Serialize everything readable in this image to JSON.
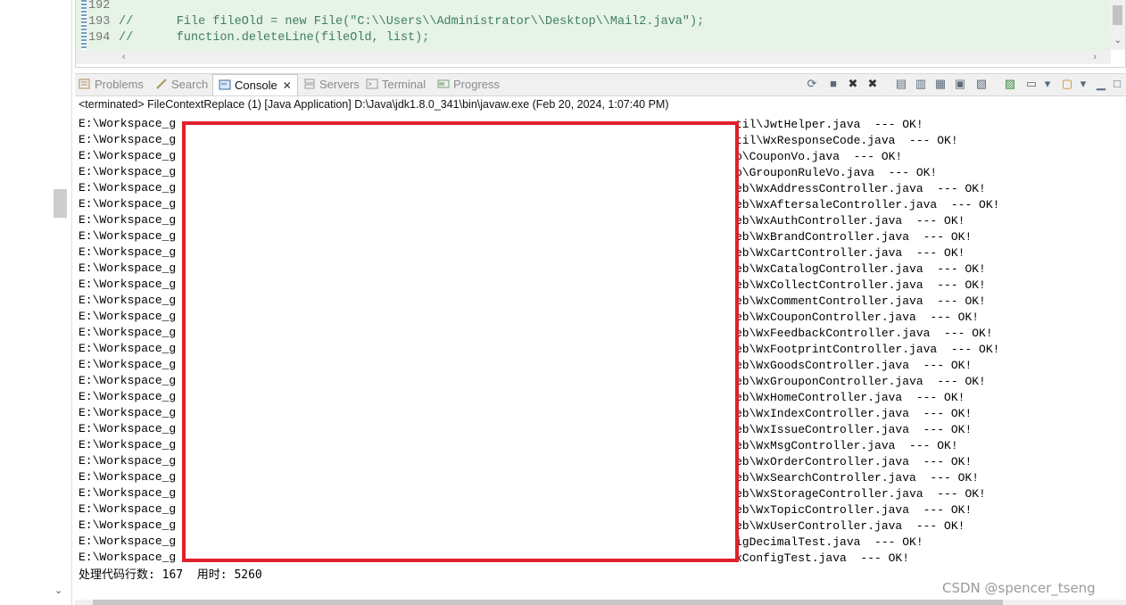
{
  "editor": {
    "lines": [
      {
        "no": "192",
        "text": ""
      },
      {
        "no": "193",
        "text": "//      File fileOld = new File(\"C:\\\\Users\\\\Administrator\\\\Desktop\\\\Mail2.java\");"
      },
      {
        "no": "194",
        "text": "//      function.deleteLine(fileOld, list);"
      }
    ]
  },
  "tabs": [
    {
      "label": "Problems",
      "icon": "problems-icon"
    },
    {
      "label": "Search",
      "icon": "search-icon"
    },
    {
      "label": "Console",
      "icon": "console-icon",
      "active": true
    },
    {
      "label": "Servers",
      "icon": "servers-icon"
    },
    {
      "label": "Terminal",
      "icon": "terminal-icon"
    },
    {
      "label": "Progress",
      "icon": "progress-icon"
    }
  ],
  "console": {
    "title": "<terminated> FileContextReplace (1) [Java Application] D:\\Java\\jdk1.8.0_341\\bin\\javaw.exe (Feb 20, 2024, 1:07:40 PM)",
    "line_prefix": "E:\\Workspace_g",
    "suffixes": [
      "til\\JwtHelper.java  --- OK!",
      "til\\WxResponseCode.java  --- OK!",
      "o\\CouponVo.java  --- OK!",
      "o\\GrouponRuleVo.java  --- OK!",
      "eb\\WxAddressController.java  --- OK!",
      "eb\\WxAftersaleController.java  --- OK!",
      "eb\\WxAuthController.java  --- OK!",
      "eb\\WxBrandController.java  --- OK!",
      "eb\\WxCartController.java  --- OK!",
      "eb\\WxCatalogController.java  --- OK!",
      "eb\\WxCollectController.java  --- OK!",
      "eb\\WxCommentController.java  --- OK!",
      "eb\\WxCouponController.java  --- OK!",
      "eb\\WxFeedbackController.java  --- OK!",
      "eb\\WxFootprintController.java  --- OK!",
      "eb\\WxGoodsController.java  --- OK!",
      "eb\\WxGrouponController.java  --- OK!",
      "eb\\WxHomeController.java  --- OK!",
      "eb\\WxIndexController.java  --- OK!",
      "eb\\WxIssueController.java  --- OK!",
      "eb\\WxMsgController.java  --- OK!",
      "eb\\WxOrderController.java  --- OK!",
      "eb\\WxSearchController.java  --- OK!",
      "eb\\WxStorageController.java  --- OK!",
      "eb\\WxTopicController.java  --- OK!",
      "eb\\WxUserController.java  --- OK!",
      "igDecimalTest.java  --- OK!",
      "xConfigTest.java  --- OK!"
    ],
    "summary": "处理代码行数: 167  用时: 5260"
  },
  "watermark": "CSDN @spencer_tseng",
  "colors": {
    "redact_border": "#e0202a",
    "editor_bg": "#e6f3e6",
    "comment": "#3f7f5f"
  }
}
